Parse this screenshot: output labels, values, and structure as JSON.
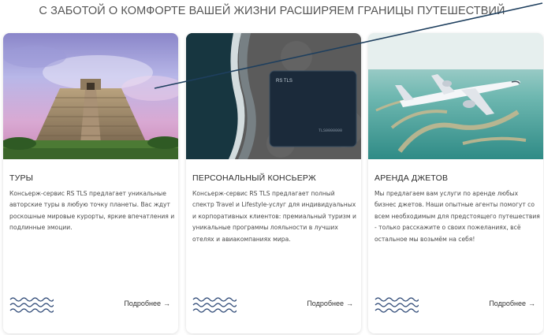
{
  "heading": "С ЗАБОТОЙ О КОМФОРТЕ ВАШЕЙ ЖИЗНИ РАСШИРЯЕМ ГРАНИЦЫ ПУТЕШЕСТВИЙ",
  "cards": [
    {
      "title": "ТУРЫ",
      "text": "Консьерж-сервис RS TLS предлагает уникальные авторские туры в любую точку планеты. Вас ждут роскошные мировые курорты, яркие впечатления и подлинные эмоции.",
      "more_label": "Подробнее",
      "image": "pyramid-photo"
    },
    {
      "title": "ПЕРСОНАЛЬНЫЙ КОНСЬЕРЖ",
      "text": "Консьерж-сервис RS TLS предлагает полный спектр Travel и Lifestyle-услуг для индивидуальных и корпоративных клиентов: премиальный туризм и уникальные программы лояльности в лучших отелях и авиакомпаниях мира.",
      "more_label": "Подробнее",
      "image": "card-on-beach-photo",
      "card_brand": "RS TLS",
      "card_number": "TLS0000000"
    },
    {
      "title": "АРЕНДА ДЖЕТОВ",
      "text": "Мы предлагаем вам услуги по аренде любых бизнес джетов. Наши опытные агенты помогут со всем необходимым для предстоящего путешествия - только расскажите о своих пожеланиях, всё остальное мы возьмём на себя!",
      "more_label": "Подробнее",
      "image": "jet-over-palm-photo"
    }
  ],
  "icons": {
    "arrow": "→",
    "wave": "wave-pattern-icon"
  },
  "colors": {
    "wave": "#2f4a77",
    "annotation_line": "#1e3f5e"
  }
}
